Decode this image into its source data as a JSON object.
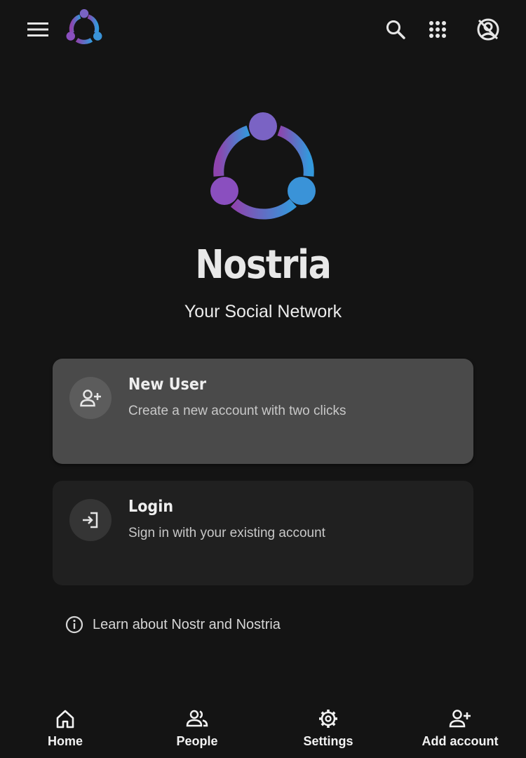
{
  "app": {
    "name": "Nostria",
    "tagline": "Your Social Network"
  },
  "header": {
    "icons": [
      "menu-icon",
      "nostria-logo",
      "search-icon",
      "apps-grid-icon",
      "no-account-icon"
    ]
  },
  "options": [
    {
      "title": "New User",
      "description": "Create a new account with two clicks",
      "icon": "person-add-icon"
    },
    {
      "title": "Login",
      "description": "Sign in with your existing account",
      "icon": "login-icon"
    }
  ],
  "learn": {
    "label": "Learn about Nostr and Nostria",
    "icon": "info-icon"
  },
  "nav": [
    {
      "label": "Home",
      "icon": "home-icon"
    },
    {
      "label": "People",
      "icon": "people-icon"
    },
    {
      "label": "Settings",
      "icon": "gear-icon"
    },
    {
      "label": "Add account",
      "icon": "person-add-icon"
    }
  ],
  "colors": {
    "background": "#141414",
    "logo_gradient_start": "#8e44ad",
    "logo_gradient_end": "#3498db",
    "card_primary": "#4a4a4a",
    "card_secondary": "#202020"
  }
}
